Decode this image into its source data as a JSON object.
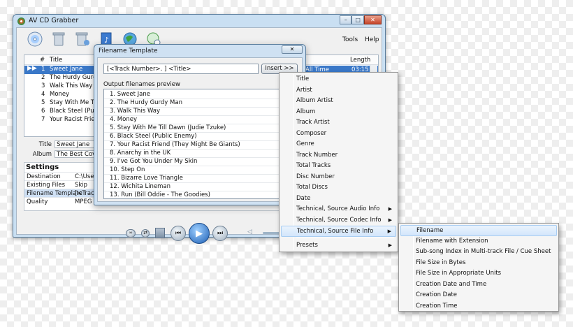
{
  "window": {
    "title": "AV CD Grabber",
    "caption": {
      "minimize": "–",
      "maximize": "□",
      "close": "✕"
    },
    "menu": {
      "tools": "Tools",
      "help": "Help"
    }
  },
  "toolbar_icons": [
    "cd-icon",
    "trash-icon",
    "trash-all-icon",
    "music-file-icon",
    "globe-icon",
    "settings-globe-icon"
  ],
  "tracklist": {
    "headers": {
      "num": "#",
      "title": "Title",
      "length": "Length"
    },
    "selected_all_time": "All Time",
    "selected_length": "03:15",
    "tracks": [
      {
        "num": "1",
        "title": "Sweet Jane"
      },
      {
        "num": "2",
        "title": "The Hurdy Gurdy Man"
      },
      {
        "num": "3",
        "title": "Walk This Way"
      },
      {
        "num": "4",
        "title": "Money"
      },
      {
        "num": "5",
        "title": "Stay With Me Till Da"
      },
      {
        "num": "6",
        "title": "Black Steel (Public E"
      },
      {
        "num": "7",
        "title": "Your Racist Friend ("
      }
    ]
  },
  "metadata": {
    "title_label": "Title",
    "title_value": "Sweet Jane",
    "album_label": "Album",
    "album_value": "The Best Covers"
  },
  "settings": {
    "heading": "Settings",
    "rows": [
      {
        "key": "Destination",
        "value": "C:\\User"
      },
      {
        "key": "Existing Files",
        "value": "Skip"
      },
      {
        "key": "Filename Template",
        "value": "[<Track"
      },
      {
        "key": "Quality",
        "value": "MPEG L"
      }
    ]
  },
  "dialog": {
    "title": "Filename Template",
    "close": "✕",
    "template_value": "[<Track Number>. ] <Title>",
    "insert_label": "Insert >>",
    "preview_label": "Output filenames preview",
    "preview": [
      "1. Sweet Jane",
      "2. The Hurdy Gurdy Man",
      "3. Walk This Way",
      "4. Money",
      "5. Stay With Me Till Dawn (Judie Tzuke)",
      "6. Black Steel (Public Enemy)",
      "7. Your Racist Friend (They Might Be Giants)",
      "8. Anarchy in the UK",
      "9. I've Got You Under My Skin",
      "10. Step On",
      "11. Bizarre Love Triangle",
      "12. Wichita Lineman",
      "13. Run (Bill Oddie - The Goodies)"
    ]
  },
  "insert_menu": {
    "items": [
      "Title",
      "Artist",
      "Album Artist",
      "Album",
      "Track Artist",
      "Composer",
      "Genre",
      "Track Number",
      "Total Tracks",
      "Disc Number",
      "Total Discs",
      "Date",
      "Technical, Source Audio Info",
      "Technical, Source Codec Info",
      "Technical, Source File Info"
    ],
    "presets": "Presets"
  },
  "file_info_menu": {
    "items": [
      "Filename",
      "Filename with Extension",
      "Sub-song Index in Multi-track File / Cue Sheet",
      "File Size in Bytes",
      "File Size in Appropriate Units",
      "Creation Date and Time",
      "Creation Date",
      "Creation Time"
    ]
  },
  "colors": {
    "selection": "#3a78c8",
    "window_frame": "#c9dff2",
    "menu_highlight": "#d3e6fb"
  }
}
